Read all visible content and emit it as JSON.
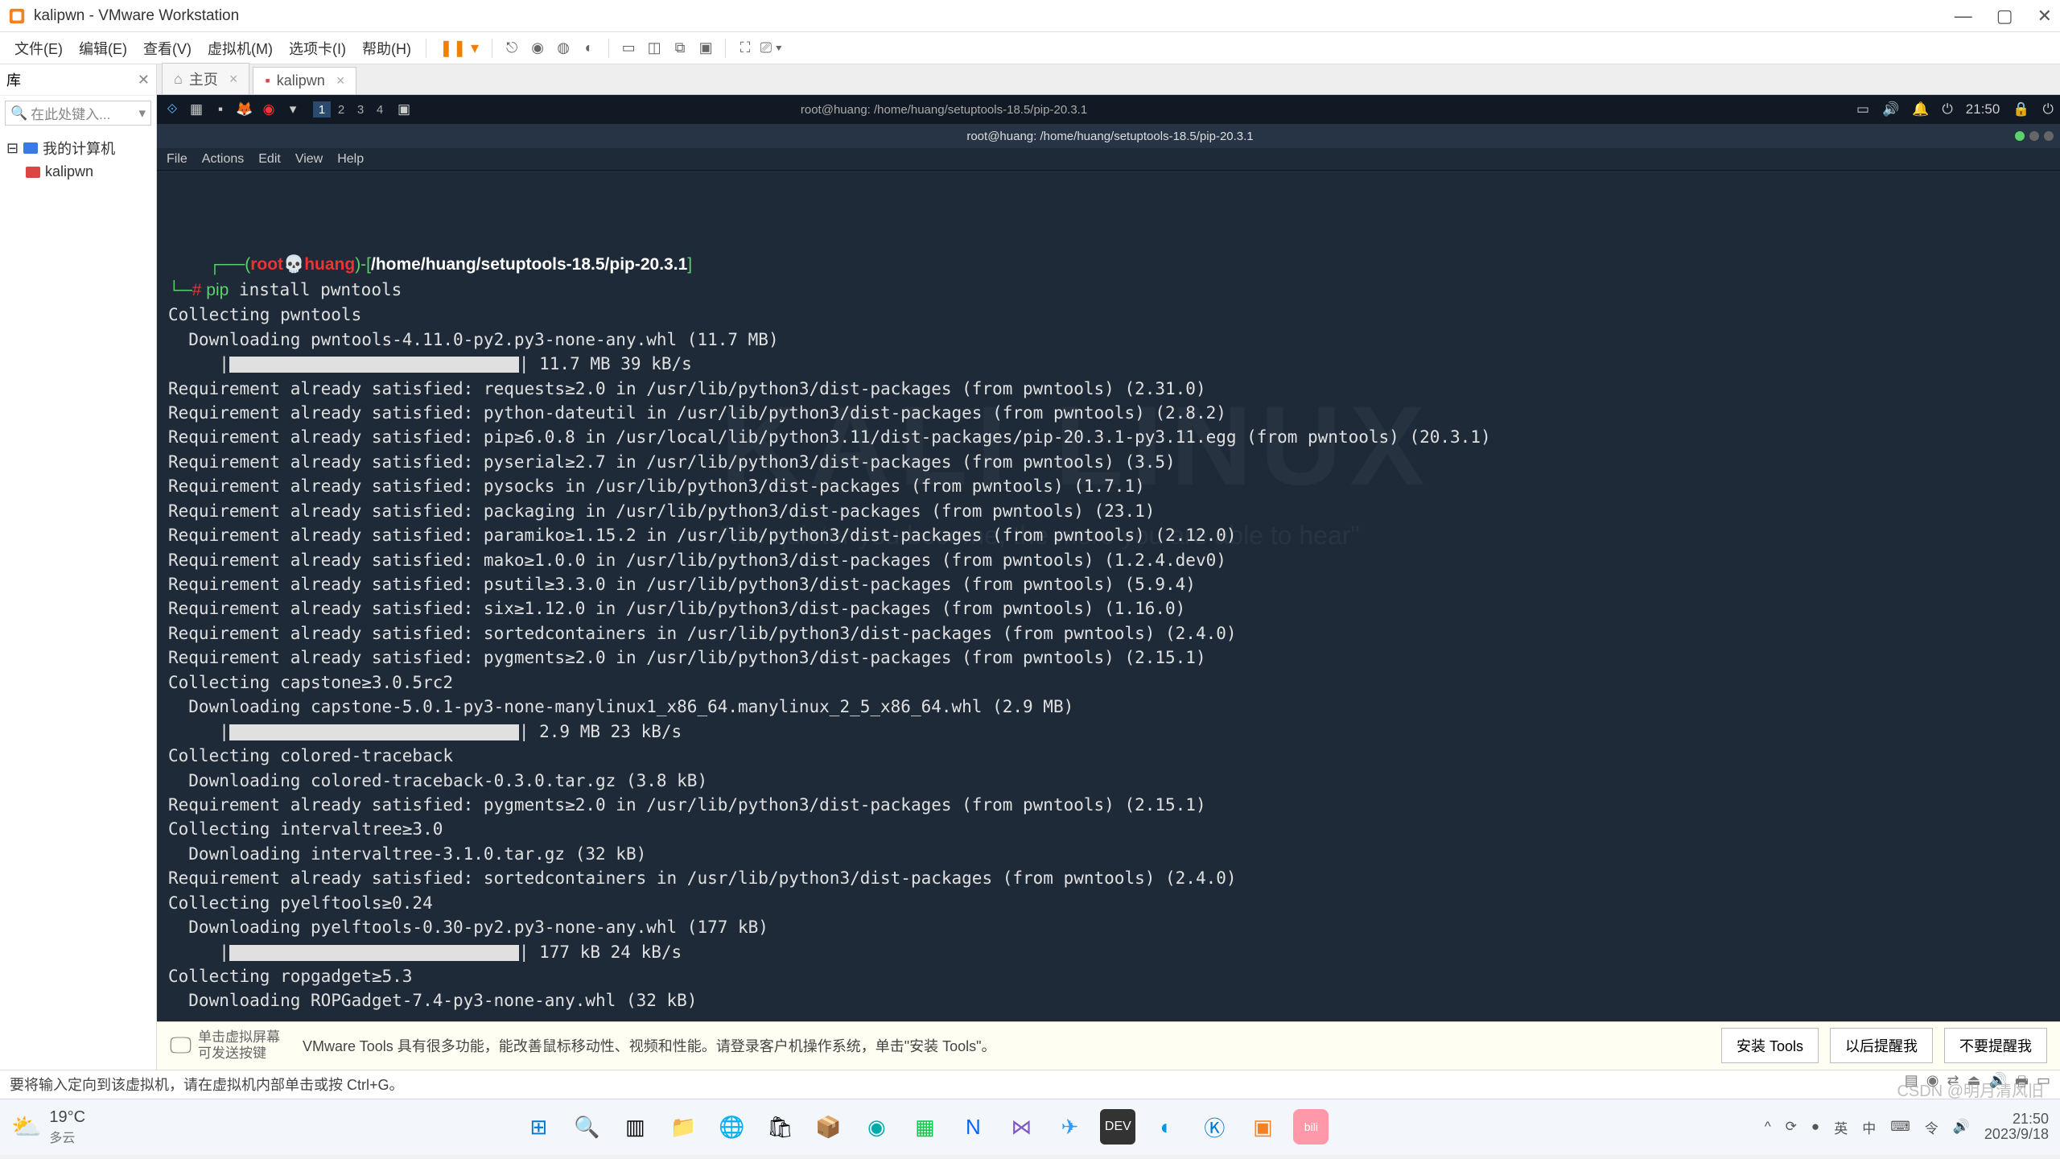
{
  "window": {
    "title": "kalipwn - VMware Workstation"
  },
  "menus": [
    "文件(E)",
    "编辑(E)",
    "查看(V)",
    "虚拟机(M)",
    "选项卡(I)",
    "帮助(H)"
  ],
  "sidebar": {
    "header": "库",
    "search_placeholder": "在此处键入...",
    "root": "我的计算机",
    "child": "kalipwn"
  },
  "tabs": [
    {
      "label": "主页"
    },
    {
      "label": "kalipwn"
    }
  ],
  "kali_top": {
    "workspaces": [
      "1",
      "2",
      "3",
      "4"
    ],
    "time": "21:50",
    "user": "root@huang: /home/huang/setuptools-18.5/pip-20.3.1"
  },
  "term_title": "root@huang: /home/huang/setuptools-18.5/pip-20.3.1",
  "term_menu": [
    "File",
    "Actions",
    "Edit",
    "View",
    "Help"
  ],
  "prompt": {
    "user": "root",
    "host": "huang",
    "path": "/home/huang/setuptools-18.5/pip-20.3.1",
    "cmd": "pip",
    "args": "install pwntools"
  },
  "lines": [
    "Collecting pwntools",
    "  Downloading pwntools-4.11.0-py2.py3-none-any.whl (11.7 MB)",
    "BAR:| 11.7 MB 39 kB/s",
    "Requirement already satisfied: requests≥2.0 in /usr/lib/python3/dist-packages (from pwntools) (2.31.0)",
    "Requirement already satisfied: python-dateutil in /usr/lib/python3/dist-packages (from pwntools) (2.8.2)",
    "Requirement already satisfied: pip≥6.0.8 in /usr/local/lib/python3.11/dist-packages/pip-20.3.1-py3.11.egg (from pwntools) (20.3.1)",
    "Requirement already satisfied: pyserial≥2.7 in /usr/lib/python3/dist-packages (from pwntools) (3.5)",
    "Requirement already satisfied: pysocks in /usr/lib/python3/dist-packages (from pwntools) (1.7.1)",
    "Requirement already satisfied: packaging in /usr/lib/python3/dist-packages (from pwntools) (23.1)",
    "Requirement already satisfied: paramiko≥1.15.2 in /usr/lib/python3/dist-packages (from pwntools) (2.12.0)",
    "Requirement already satisfied: mako≥1.0.0 in /usr/lib/python3/dist-packages (from pwntools) (1.2.4.dev0)",
    "Requirement already satisfied: psutil≥3.3.0 in /usr/lib/python3/dist-packages (from pwntools) (5.9.4)",
    "Requirement already satisfied: six≥1.12.0 in /usr/lib/python3/dist-packages (from pwntools) (1.16.0)",
    "Requirement already satisfied: sortedcontainers in /usr/lib/python3/dist-packages (from pwntools) (2.4.0)",
    "Requirement already satisfied: pygments≥2.0 in /usr/lib/python3/dist-packages (from pwntools) (2.15.1)",
    "Collecting capstone≥3.0.5rc2",
    "  Downloading capstone-5.0.1-py3-none-manylinux1_x86_64.manylinux_2_5_x86_64.whl (2.9 MB)",
    "BAR:| 2.9 MB 23 kB/s",
    "Collecting colored-traceback",
    "  Downloading colored-traceback-0.3.0.tar.gz (3.8 kB)",
    "Requirement already satisfied: pygments≥2.0 in /usr/lib/python3/dist-packages (from pwntools) (2.15.1)",
    "Collecting intervaltree≥3.0",
    "  Downloading intervaltree-3.1.0.tar.gz (32 kB)",
    "Requirement already satisfied: sortedcontainers in /usr/lib/python3/dist-packages (from pwntools) (2.4.0)",
    "Collecting pyelftools≥0.24",
    "  Downloading pyelftools-0.30-py2.py3-none-any.whl (177 kB)",
    "BAR:| 177 kB 24 kB/s",
    "Collecting ropgadget≥5.3",
    "  Downloading ROPGadget-7.4-py3-none-any.whl (32 kB)"
  ],
  "watermark": "KALI LINUX",
  "watermark2": "\"the quieter you become, the more you are able to hear\"",
  "toolsbar": {
    "hint1": "单击虚拟屏幕",
    "hint2": "可发送按键",
    "msg": "VMware Tools 具有很多功能，能改善鼠标移动性、视频和性能。请登录客户机操作系统，单击\"安装 Tools\"。",
    "b1": "安装 Tools",
    "b2": "以后提醒我",
    "b3": "不要提醒我"
  },
  "status": {
    "msg": "要将输入定向到该虚拟机，请在虚拟机内部单击或按 Ctrl+G。"
  },
  "taskbar": {
    "temp": "19°C",
    "weather": "多云",
    "tray": [
      "^",
      "⟳",
      "●",
      "英",
      "中",
      "⌨",
      "令",
      "🔊"
    ],
    "time": "21:50",
    "date": "2023/9/18"
  },
  "csdn": "CSDN @明月清风旧"
}
